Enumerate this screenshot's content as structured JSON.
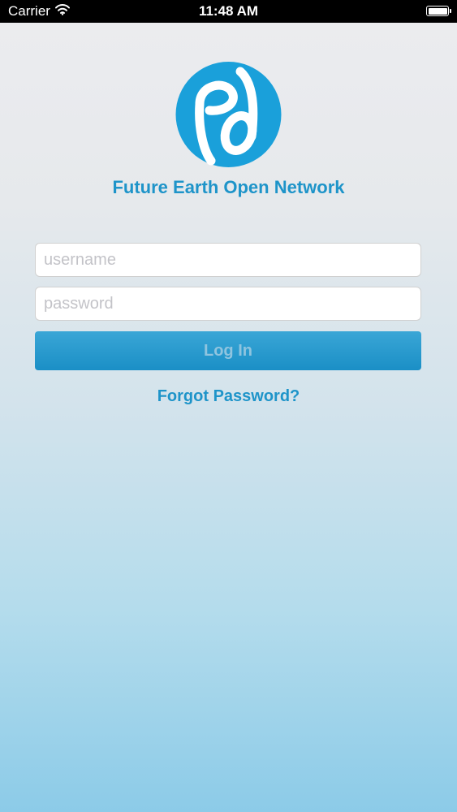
{
  "status_bar": {
    "carrier": "Carrier",
    "time": "11:48 AM"
  },
  "app": {
    "title": "Future Earth Open Network",
    "brand_color": "#1e94c9"
  },
  "login_form": {
    "username_placeholder": "username",
    "password_placeholder": "password",
    "login_label": "Log In",
    "forgot_label": "Forgot Password?"
  },
  "icons": [
    "wifi-icon",
    "battery-icon",
    "future-earth-logo-icon"
  ]
}
